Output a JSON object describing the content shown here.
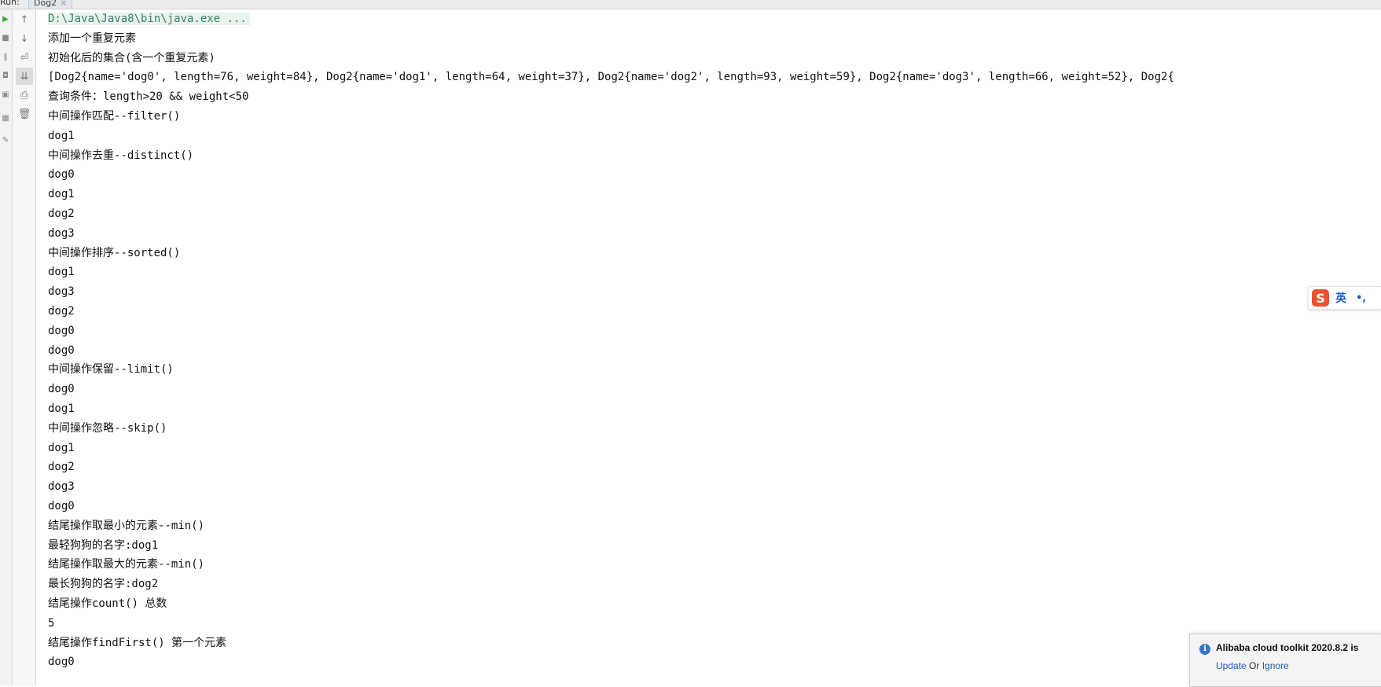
{
  "tabs": {
    "run_label": "Run:",
    "file_label": "Dog2",
    "close_glyph": "×"
  },
  "toolbar": {
    "items": [
      "up-arrow-icon",
      "down-arrow-icon",
      "soft-wrap-icon",
      "scroll-to-end-icon",
      "print-icon",
      "clear-icon"
    ]
  },
  "console": {
    "command": "D:\\Java\\Java8\\bin\\java.exe ...",
    "lines": [
      "添加一个重复元素",
      "初始化后的集合(含一个重复元素)",
      "[Dog2{name='dog0', length=76, weight=84}, Dog2{name='dog1', length=64, weight=37}, Dog2{name='dog2', length=93, weight=59}, Dog2{name='dog3', length=66, weight=52}, Dog2{",
      "查询条件：length>20 && weight<50",
      "中间操作匹配--filter()",
      "dog1",
      "中间操作去重--distinct()",
      "dog0",
      "dog1",
      "dog2",
      "dog3",
      "中间操作排序--sorted()",
      "dog1",
      "dog3",
      "dog2",
      "dog0",
      "dog0",
      "中间操作保留--limit()",
      "dog0",
      "dog1",
      "中间操作忽略--skip()",
      "dog1",
      "dog2",
      "dog3",
      "dog0",
      "结尾操作取最小的元素--min()",
      "最轻狗狗的名字:dog1",
      "结尾操作取最大的元素--min()",
      "最长狗狗的名字:dog2",
      "结尾操作count() 总数",
      "5",
      "结尾操作findFirst() 第一个元素",
      "dog0"
    ]
  },
  "ime": {
    "logo": "S",
    "mode": "英",
    "punct": "•,"
  },
  "notification": {
    "title": "Alibaba cloud toolkit 2020.8.2 is",
    "update_label": "Update",
    "or_label": " Or ",
    "ignore_label": "Ignore"
  },
  "colors": {
    "command_text": "#3a7f6b",
    "link": "#2159c4",
    "ime_logo": "#e8542e"
  }
}
